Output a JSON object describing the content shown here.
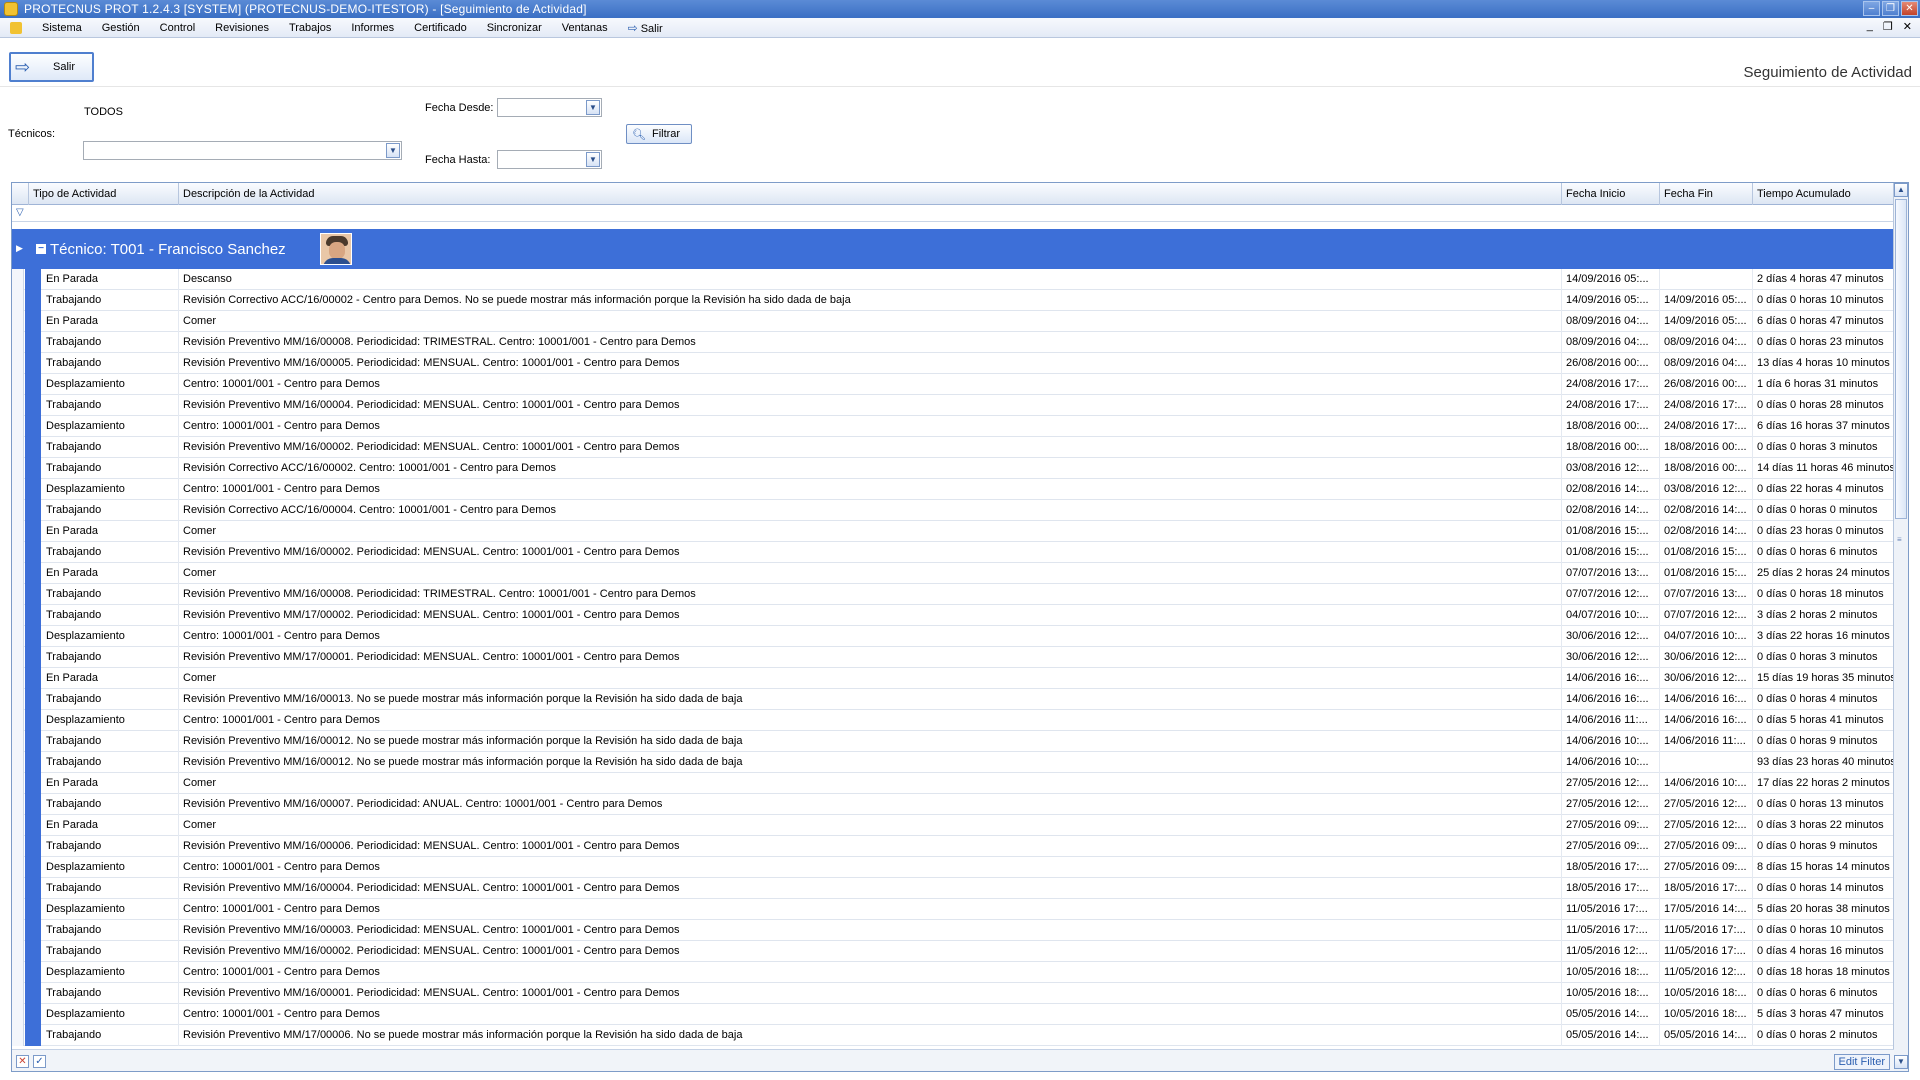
{
  "window": {
    "title": "PROTECNUS PROT 1.2.4.3 [SYSTEM] (PROTECNUS-DEMO-ITESTOR) - [Seguimiento de Actividad]"
  },
  "menu": {
    "items": [
      "Sistema",
      "Gestión",
      "Control",
      "Revisiones",
      "Trabajos",
      "Informes",
      "Certificado",
      "Sincronizar",
      "Ventanas"
    ],
    "salir": "Salir"
  },
  "toolbar": {
    "salir_label": "Salir",
    "page_title": "Seguimiento de Actividad"
  },
  "filters": {
    "tecnicos_label": "Técnicos:",
    "tecnicos_value": "TODOS",
    "fecha_desde_label": "Fecha Desde:",
    "fecha_hasta_label": "Fecha Hasta:",
    "filtrar_label": "Filtrar"
  },
  "grid": {
    "columns": [
      "Tipo de Actividad",
      "Descripción de la Actividad",
      "Fecha Inicio",
      "Fecha Fin",
      "Tiempo Acumulado"
    ],
    "group_label": "Técnico: T001 - Francisco Sanchez",
    "rows": [
      [
        "En Parada",
        "Descanso",
        "14/09/2016 05:...",
        "",
        "2 días 4 horas 47 minutos"
      ],
      [
        "Trabajando",
        "Revisión Correctivo ACC/16/00002 - Centro para Demos. No se puede mostrar más información porque la Revisión ha sido dada de baja",
        "14/09/2016 05:...",
        "14/09/2016 05:...",
        "0 días 0 horas 10 minutos"
      ],
      [
        "En Parada",
        "Comer",
        "08/09/2016 04:...",
        "14/09/2016 05:...",
        "6 días 0 horas 47 minutos"
      ],
      [
        "Trabajando",
        "Revisión Preventivo MM/16/00008. Periodicidad: TRIMESTRAL. Centro: 10001/001 - Centro para Demos",
        "08/09/2016 04:...",
        "08/09/2016 04:...",
        "0 días 0 horas 23 minutos"
      ],
      [
        "Trabajando",
        "Revisión Preventivo MM/16/00005. Periodicidad: MENSUAL. Centro: 10001/001 - Centro para Demos",
        "26/08/2016 00:...",
        "08/09/2016 04:...",
        "13 días 4 horas 10 minutos"
      ],
      [
        "Desplazamiento",
        "Centro: 10001/001 - Centro para Demos",
        "24/08/2016 17:...",
        "26/08/2016 00:...",
        "1 día 6 horas 31 minutos"
      ],
      [
        "Trabajando",
        "Revisión Preventivo MM/16/00004. Periodicidad: MENSUAL. Centro: 10001/001 - Centro para Demos",
        "24/08/2016 17:...",
        "24/08/2016 17:...",
        "0 días 0 horas 28 minutos"
      ],
      [
        "Desplazamiento",
        "Centro: 10001/001 - Centro para Demos",
        "18/08/2016 00:...",
        "24/08/2016 17:...",
        "6 días 16 horas 37 minutos"
      ],
      [
        "Trabajando",
        "Revisión Preventivo MM/16/00002. Periodicidad: MENSUAL. Centro: 10001/001 - Centro para Demos",
        "18/08/2016 00:...",
        "18/08/2016 00:...",
        "0 días 0 horas 3 minutos"
      ],
      [
        "Trabajando",
        "Revisión Correctivo ACC/16/00002. Centro: 10001/001 - Centro para Demos",
        "03/08/2016 12:...",
        "18/08/2016 00:...",
        "14 días 11 horas 46 minutos"
      ],
      [
        "Desplazamiento",
        "Centro: 10001/001 - Centro para Demos",
        "02/08/2016 14:...",
        "03/08/2016 12:...",
        "0 días 22 horas 4 minutos"
      ],
      [
        "Trabajando",
        "Revisión Correctivo ACC/16/00004. Centro: 10001/001 - Centro para Demos",
        "02/08/2016 14:...",
        "02/08/2016 14:...",
        "0 días 0 horas 0 minutos"
      ],
      [
        "En Parada",
        "Comer",
        "01/08/2016 15:...",
        "02/08/2016 14:...",
        "0 días 23 horas 0 minutos"
      ],
      [
        "Trabajando",
        "Revisión Preventivo MM/16/00002. Periodicidad: MENSUAL. Centro: 10001/001 - Centro para Demos",
        "01/08/2016 15:...",
        "01/08/2016 15:...",
        "0 días 0 horas 6 minutos"
      ],
      [
        "En Parada",
        "Comer",
        "07/07/2016 13:...",
        "01/08/2016 15:...",
        "25 días 2 horas 24 minutos"
      ],
      [
        "Trabajando",
        "Revisión Preventivo MM/16/00008. Periodicidad: TRIMESTRAL. Centro: 10001/001 - Centro para Demos",
        "07/07/2016 12:...",
        "07/07/2016 13:...",
        "0 días 0 horas 18 minutos"
      ],
      [
        "Trabajando",
        "Revisión Preventivo MM/17/00002. Periodicidad: MENSUAL. Centro: 10001/001 - Centro para Demos",
        "04/07/2016 10:...",
        "07/07/2016 12:...",
        "3 días 2 horas 2 minutos"
      ],
      [
        "Desplazamiento",
        "Centro: 10001/001 - Centro para Demos",
        "30/06/2016 12:...",
        "04/07/2016 10:...",
        "3 días 22 horas 16 minutos"
      ],
      [
        "Trabajando",
        "Revisión Preventivo MM/17/00001. Periodicidad: MENSUAL. Centro: 10001/001 - Centro para Demos",
        "30/06/2016 12:...",
        "30/06/2016 12:...",
        "0 días 0 horas 3 minutos"
      ],
      [
        "En Parada",
        "Comer",
        "14/06/2016 16:...",
        "30/06/2016 12:...",
        "15 días 19 horas 35 minutos"
      ],
      [
        "Trabajando",
        "Revisión Preventivo MM/16/00013. No se puede mostrar más información porque la Revisión ha sido dada de baja",
        "14/06/2016 16:...",
        "14/06/2016 16:...",
        "0 días 0 horas 4 minutos"
      ],
      [
        "Desplazamiento",
        "Centro: 10001/001 - Centro para Demos",
        "14/06/2016 11:...",
        "14/06/2016 16:...",
        "0 días 5 horas 41 minutos"
      ],
      [
        "Trabajando",
        "Revisión Preventivo MM/16/00012. No se puede mostrar más información porque la Revisión ha sido dada de baja",
        "14/06/2016 10:...",
        "14/06/2016 11:...",
        "0 días 0 horas 9 minutos"
      ],
      [
        "Trabajando",
        "Revisión Preventivo MM/16/00012. No se puede mostrar más información porque la Revisión ha sido dada de baja",
        "14/06/2016 10:...",
        "",
        "93 días 23 horas 40 minutos"
      ],
      [
        "En Parada",
        "Comer",
        "27/05/2016 12:...",
        "14/06/2016 10:...",
        "17 días 22 horas 2 minutos"
      ],
      [
        "Trabajando",
        "Revisión Preventivo MM/16/00007. Periodicidad: ANUAL. Centro: 10001/001 - Centro para Demos",
        "27/05/2016 12:...",
        "27/05/2016 12:...",
        "0 días 0 horas 13 minutos"
      ],
      [
        "En Parada",
        "Comer",
        "27/05/2016 09:...",
        "27/05/2016 12:...",
        "0 días 3 horas 22 minutos"
      ],
      [
        "Trabajando",
        "Revisión Preventivo MM/16/00006. Periodicidad: MENSUAL. Centro: 10001/001 - Centro para Demos",
        "27/05/2016 09:...",
        "27/05/2016 09:...",
        "0 días 0 horas 9 minutos"
      ],
      [
        "Desplazamiento",
        "Centro: 10001/001 - Centro para Demos",
        "18/05/2016 17:...",
        "27/05/2016 09:...",
        "8 días 15 horas 14 minutos"
      ],
      [
        "Trabajando",
        "Revisión Preventivo MM/16/00004. Periodicidad: MENSUAL. Centro: 10001/001 - Centro para Demos",
        "18/05/2016 17:...",
        "18/05/2016 17:...",
        "0 días 0 horas 14 minutos"
      ],
      [
        "Desplazamiento",
        "Centro: 10001/001 - Centro para Demos",
        "11/05/2016 17:...",
        "17/05/2016 14:...",
        "5 días 20 horas 38 minutos"
      ],
      [
        "Trabajando",
        "Revisión Preventivo MM/16/00003. Periodicidad: MENSUAL. Centro: 10001/001 - Centro para Demos",
        "11/05/2016 17:...",
        "11/05/2016 17:...",
        "0 días 0 horas 10 minutos"
      ],
      [
        "Trabajando",
        "Revisión Preventivo MM/16/00002. Periodicidad: MENSUAL. Centro: 10001/001 - Centro para Demos",
        "11/05/2016 12:...",
        "11/05/2016 17:...",
        "0 días 4 horas 16 minutos"
      ],
      [
        "Desplazamiento",
        "Centro: 10001/001 - Centro para Demos",
        "10/05/2016 18:...",
        "11/05/2016 12:...",
        "0 días 18 horas 18 minutos"
      ],
      [
        "Trabajando",
        "Revisión Preventivo MM/16/00001. Periodicidad: MENSUAL. Centro: 10001/001 - Centro para Demos",
        "10/05/2016 18:...",
        "10/05/2016 18:...",
        "0 días 0 horas 6 minutos"
      ],
      [
        "Desplazamiento",
        "Centro: 10001/001 - Centro para Demos",
        "05/05/2016 14:...",
        "10/05/2016 18:...",
        "5 días 3 horas 47 minutos"
      ],
      [
        "Trabajando",
        "Revisión Preventivo MM/17/00006. No se puede mostrar más información porque la Revisión ha sido dada de baja",
        "05/05/2016 14:...",
        "05/05/2016 14:...",
        "0 días 0 horas 2 minutos"
      ]
    ],
    "edit_filter_label": "Edit Filter"
  },
  "colors": {
    "accent": "#3d6fd8",
    "titlebar": "#3a6fc4"
  }
}
